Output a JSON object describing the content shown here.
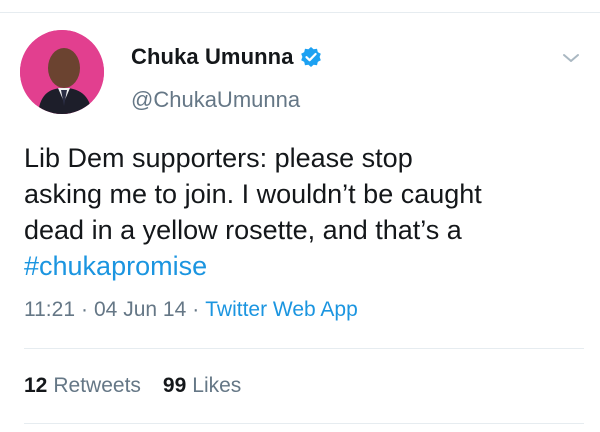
{
  "author": {
    "display_name": "Chuka Umunna",
    "handle": "@ChukaUmunna",
    "verified_icon": "verified-badge-icon",
    "avatar_background": "#e23f8f"
  },
  "tweet": {
    "text": "Lib Dem supporters: please stop\nasking me to join. I wouldn’t be caught\ndead in a yellow rosette, and that’s a\n",
    "hashtag": "#chukapromise"
  },
  "meta": {
    "time": "11:21",
    "separator_1": "·",
    "date": "04 Jun 14",
    "separator_2": "·",
    "source": "Twitter Web App"
  },
  "stats": {
    "retweets_count": "12",
    "retweets_label": "Retweets",
    "likes_count": "99",
    "likes_label": "Likes"
  },
  "colors": {
    "link": "#1b95e0",
    "secondary_text": "#657786",
    "primary_text": "#14171a",
    "divider": "#e6ecf0"
  },
  "icons": {
    "caret": "chevron-down-icon"
  }
}
